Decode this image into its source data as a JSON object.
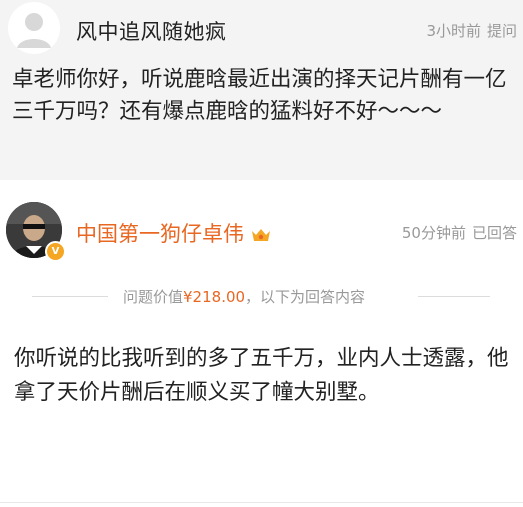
{
  "question": {
    "asker_name": "风中追风随她疯",
    "time": "3小时前",
    "action": "提问",
    "text": "卓老师你好，听说鹿晗最近出演的择天记片酬有一亿三千万吗？还有爆点鹿晗的猛料好不好～～～"
  },
  "answer": {
    "answerer_name": "中国第一狗仔卓伟",
    "time": "50分钟前",
    "status": "已回答",
    "price_prefix": "问题价值",
    "price": "¥218.00",
    "price_suffix": "，以下为回答内容",
    "text": "你听说的比我听到的多了五千万，业内人士透露，他拿了天价片酬后在顺义买了幢大别墅。"
  },
  "colors": {
    "accent": "#e86722",
    "meta": "#999999",
    "question_bg": "#f4f4f4",
    "verified_badge": "#f5a623"
  },
  "icons": [
    "default-avatar-icon",
    "user-avatar-photo",
    "verified-badge-icon",
    "crown-icon"
  ]
}
